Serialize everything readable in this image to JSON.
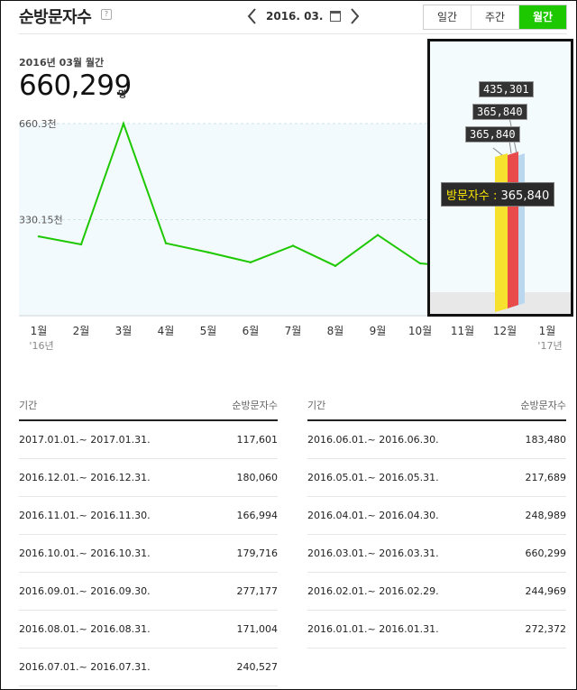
{
  "header": {
    "title": "순방문자수",
    "help": "?",
    "date": "2016. 03.",
    "tabs": [
      {
        "label": "일간",
        "active": false
      },
      {
        "label": "주간",
        "active": false
      },
      {
        "label": "월간",
        "active": true
      }
    ]
  },
  "summary": {
    "period": "2016년 03월 월간",
    "value": "660,299",
    "unit": "명"
  },
  "chart_data": {
    "type": "line",
    "color": "#1ec800",
    "x": [
      "1월",
      "2월",
      "3월",
      "4월",
      "5월",
      "6월",
      "7월",
      "8월",
      "9월",
      "10월",
      "11월",
      "12월",
      "1월"
    ],
    "x_sub": [
      "'16년",
      "",
      "",
      "",
      "",
      "",
      "",
      "",
      "",
      "",
      "",
      "",
      "'17년"
    ],
    "values": [
      272372,
      244969,
      660299,
      248989,
      217689,
      183480,
      240527,
      171004,
      277177,
      179716,
      166994,
      180060,
      117601
    ],
    "y_ticks": [
      {
        "value": 330150,
        "label": "330.15천"
      },
      {
        "value": 660300,
        "label": "660.3천"
      }
    ],
    "ylim": [
      0,
      660300
    ]
  },
  "inset": {
    "tags": [
      "435,301",
      "365,840",
      "365,840"
    ],
    "tooltip_key": "방문자수 :",
    "tooltip_value": "365,840"
  },
  "table": {
    "col_period": "기간",
    "col_value": "순방문자수",
    "left": [
      {
        "period": "2017.01.01.~ 2017.01.31.",
        "value": "117,601"
      },
      {
        "period": "2016.12.01.~ 2016.12.31.",
        "value": "180,060"
      },
      {
        "period": "2016.11.01.~ 2016.11.30.",
        "value": "166,994"
      },
      {
        "period": "2016.10.01.~ 2016.10.31.",
        "value": "179,716"
      },
      {
        "period": "2016.09.01.~ 2016.09.30.",
        "value": "277,177"
      },
      {
        "period": "2016.08.01.~ 2016.08.31.",
        "value": "171,004"
      },
      {
        "period": "2016.07.01.~ 2016.07.31.",
        "value": "240,527"
      }
    ],
    "right": [
      {
        "period": "2016.06.01.~ 2016.06.30.",
        "value": "183,480"
      },
      {
        "period": "2016.05.01.~ 2016.05.31.",
        "value": "217,689"
      },
      {
        "period": "2016.04.01.~ 2016.04.30.",
        "value": "248,989"
      },
      {
        "period": "2016.03.01.~ 2016.03.31.",
        "value": "660,299"
      },
      {
        "period": "2016.02.01.~ 2016.02.29.",
        "value": "244,969"
      },
      {
        "period": "2016.01.01.~ 2016.01.31.",
        "value": "272,372"
      }
    ]
  }
}
